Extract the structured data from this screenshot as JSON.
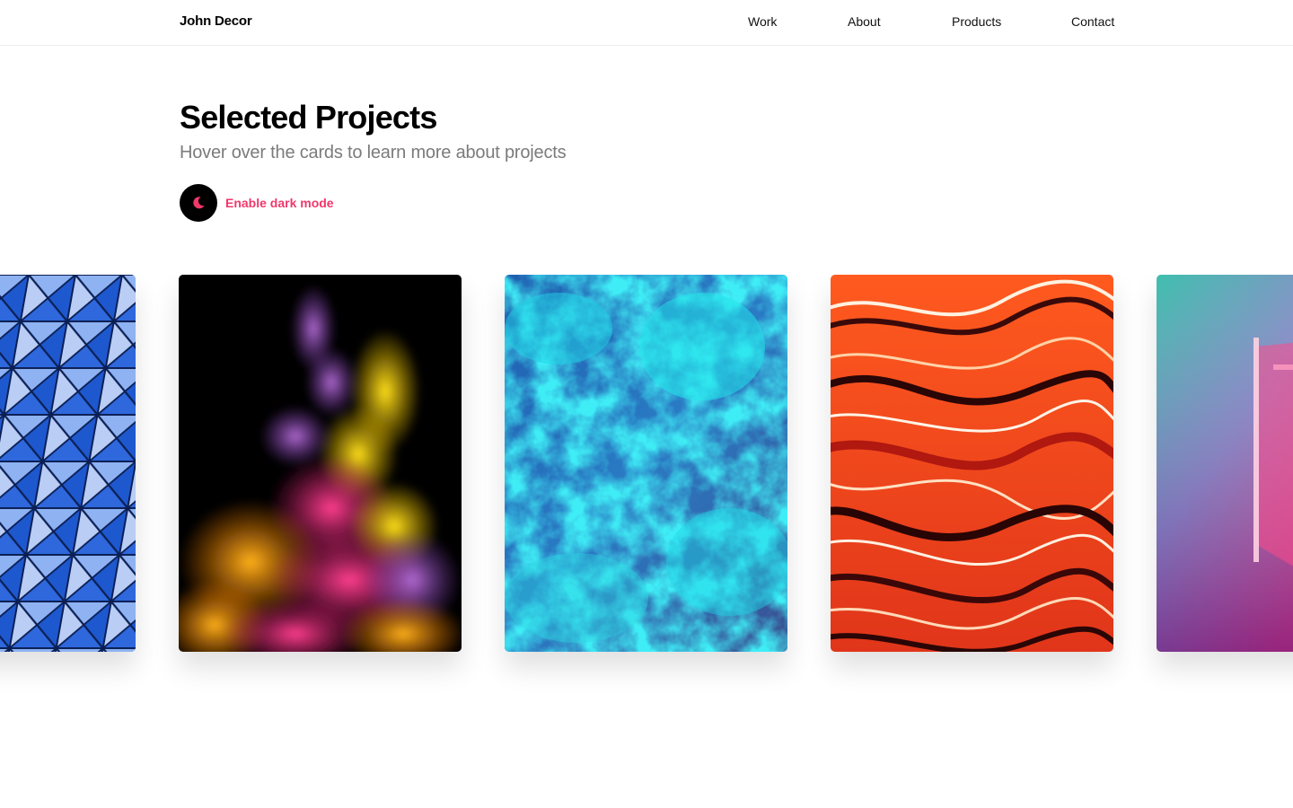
{
  "header": {
    "brand": "John Decor",
    "nav": [
      {
        "label": "Work"
      },
      {
        "label": "About"
      },
      {
        "label": "Products"
      },
      {
        "label": "Contact"
      }
    ]
  },
  "hero": {
    "title": "Selected Projects",
    "subtitle": "Hover over the cards to learn more about projects",
    "dark_mode_label": "Enable dark mode",
    "dark_mode_icon": "moon-icon"
  },
  "cards": [
    {
      "image": "blue-geometric-facade"
    },
    {
      "image": "colorful-ink-smoke"
    },
    {
      "image": "turquoise-marble-texture"
    },
    {
      "image": "red-orange-marble-waves"
    },
    {
      "image": "neon-pink-corridor"
    }
  ],
  "colors": {
    "accent": "#f0386b",
    "text": "#000000",
    "muted": "#7b7b7b",
    "border": "#ededed"
  }
}
